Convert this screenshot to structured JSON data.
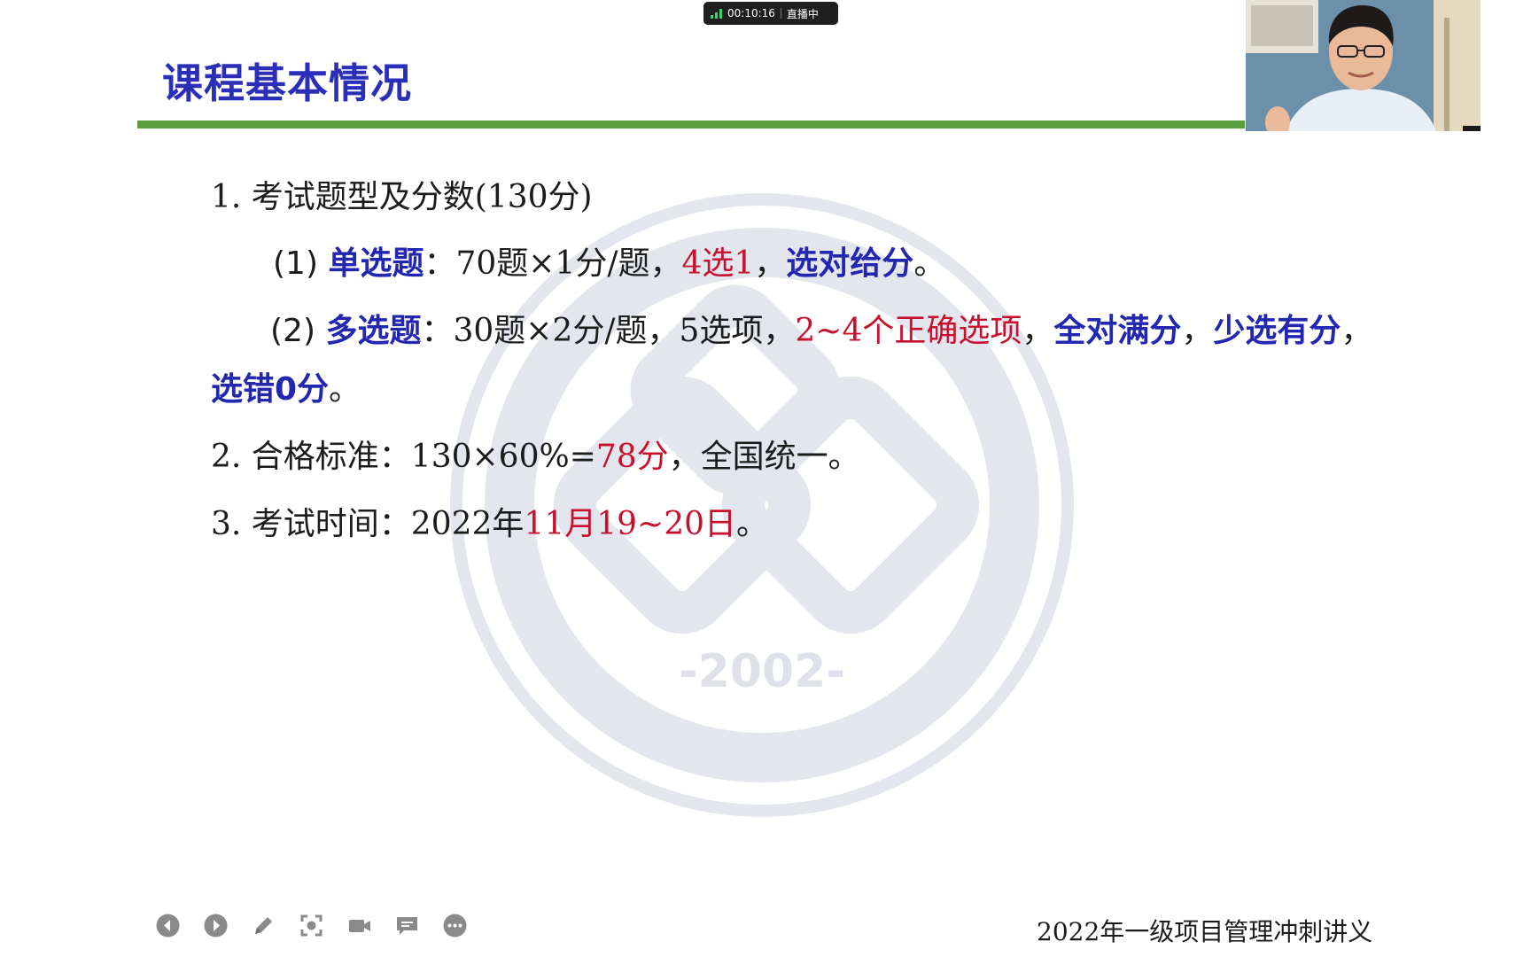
{
  "live_indicator": {
    "time": "00:10:16",
    "status": "直播中",
    "signal_color": "#3bd16f"
  },
  "slide": {
    "title": "课程基本情况",
    "title_color": "#2b2fb8",
    "rule_color": "#5aa03c",
    "line1": "1. 考试题型及分数(130分)",
    "line2": {
      "prefix": "(1) ",
      "term": "单选题",
      "mid": "：70题×1分/题，",
      "red": "4选1",
      "sep": "，",
      "bold": "选对给分",
      "end": "。"
    },
    "line3": {
      "prefix": "(2) ",
      "term": "多选题",
      "mid": "：30题×2分/题，5选项，",
      "red": "2~4个正确选项",
      "sep1": "，",
      "bold1": "全对满分",
      "sep2": "，",
      "bold2": "少选有分",
      "end": "，"
    },
    "line4": {
      "bold": "选错0分",
      "end": "。"
    },
    "line5": {
      "prefix": "2. 合格标准：130×60%=",
      "red": "78分",
      "end": "，全国统一。"
    },
    "line6": {
      "prefix": "3. 考试时间：2022年",
      "red": "11月19~20日",
      "end": "。"
    },
    "watermark_year": "-2002-",
    "footer": "2022年一级项目管理冲刺讲义"
  },
  "toolbar": {
    "icons": [
      "prev-icon",
      "next-icon",
      "pen-icon",
      "screenshot-icon",
      "camera-icon",
      "comment-icon",
      "more-icon"
    ]
  }
}
